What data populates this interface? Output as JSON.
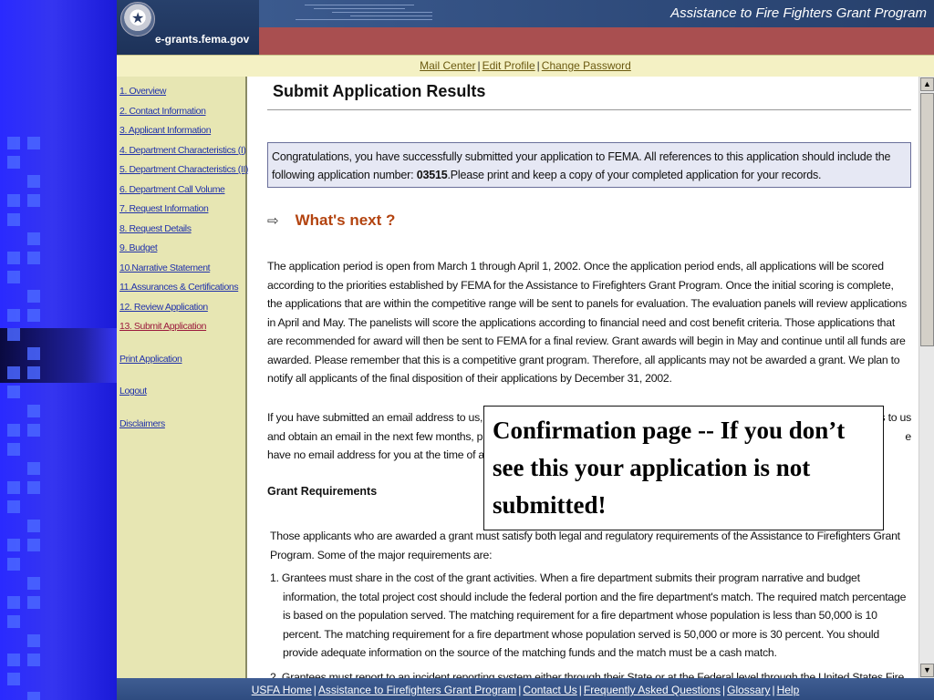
{
  "header": {
    "site_name": "e-grants.fema.gov",
    "program_title": "Assistance to Fire Fighters Grant Program"
  },
  "account_links": [
    "Mail Center",
    "Edit Profile",
    "Change Password"
  ],
  "sidebar": {
    "items": [
      {
        "label": "1. Overview"
      },
      {
        "label": "2. Contact Information"
      },
      {
        "label": "3. Applicant Information"
      },
      {
        "label": "4. Department Characteristics (I)"
      },
      {
        "label": "5. Department Characteristics (II)"
      },
      {
        "label": "6. Department Call Volume"
      },
      {
        "label": "7. Request Information"
      },
      {
        "label": "8. Request Details"
      },
      {
        "label": "9. Budget"
      },
      {
        "label": "10.Narrative Statement"
      },
      {
        "label": "11.Assurances & Certifications"
      },
      {
        "label": "12. Review Application"
      },
      {
        "label": "13. Submit Application",
        "current": true
      }
    ],
    "print_label": "Print Application",
    "logout_label": "Logout",
    "disclaimers_label": "Disclaimers"
  },
  "main": {
    "title": "Submit Application Results",
    "congrats_before": "Congratulations, you have successfully submitted your application to FEMA. All references to this application should include the following application number: ",
    "application_number": "03515",
    "congrats_after": ".Please print and keep a copy of your completed application for your records.",
    "whats_next": "What's next ?",
    "para1": "The application period is open from March 1 through April 1, 2002. Once the application period ends, all applications will be scored according to the priorities established by FEMA for the Assistance to Firefighters Grant Program. Once the initial scoring is complete, the applications that are within the competitive range will be sent to panels for evaluation. The evaluation panels will review applications in April and May. The panelists will score the applications according to financial need and cost benefit criteria. Those applications that are recommended for award will then be sent to FEMA for a final review. Grant awards will begin in May and continue until all funds are awarded. Please remember that this is a competitive grant program. Therefore, all applicants may not be awarded a grant. We plan to notify all applicants of the final disposition of their applications by December 31, 2002.",
    "para2_line1": "If you have submitted an email address to us, y",
    "para2_line1_end": "s to us",
    "para2_line2": "and obtain an email in the next few months, pl",
    "para2_line2_end": "e",
    "para2_line3": "have no email address for you at the time of aw",
    "grant_heading": "Grant Requirements",
    "grant_intro": "Those applicants who are awarded a grant must satisfy both legal and regulatory requirements of the Assistance to Firefighters Grant Program. Some of the major requirements are:",
    "requirements": [
      "1. Grantees must share in the cost of the grant activities. When a fire department submits their program narrative and budget information, the total project cost should include the federal portion and the fire department's match. The required match percentage is based on the population served. The matching requirement for a fire department whose population is less than 50,000 is 10 percent. The matching requirement for a fire department whose population served is 50,000 or more is 30 percent. You should provide adequate information on the source of the matching funds and the match must be a cash match.",
      "2. Grantees must report to an incident reporting system either through their State or at the Federal level through the United States Fire"
    ]
  },
  "callout": "Confirmation page -- If you don’t see this your application is not submitted!",
  "footer_links": [
    "USFA Home",
    "Assistance to Firefighters Grant Program",
    "Contact Us",
    "Frequently Asked Questions",
    "Glossary",
    "Help"
  ],
  "icons": [
    "seal-icon",
    "arrow-right-icon",
    "scroll-up-icon",
    "scroll-down-icon"
  ],
  "colors": {
    "header_blue": "#2e4a7a",
    "header_red": "#a94f50",
    "sidebar_bg": "#e7e6b3",
    "heading_orange": "#b34410",
    "current_link": "#9b1a3c"
  }
}
